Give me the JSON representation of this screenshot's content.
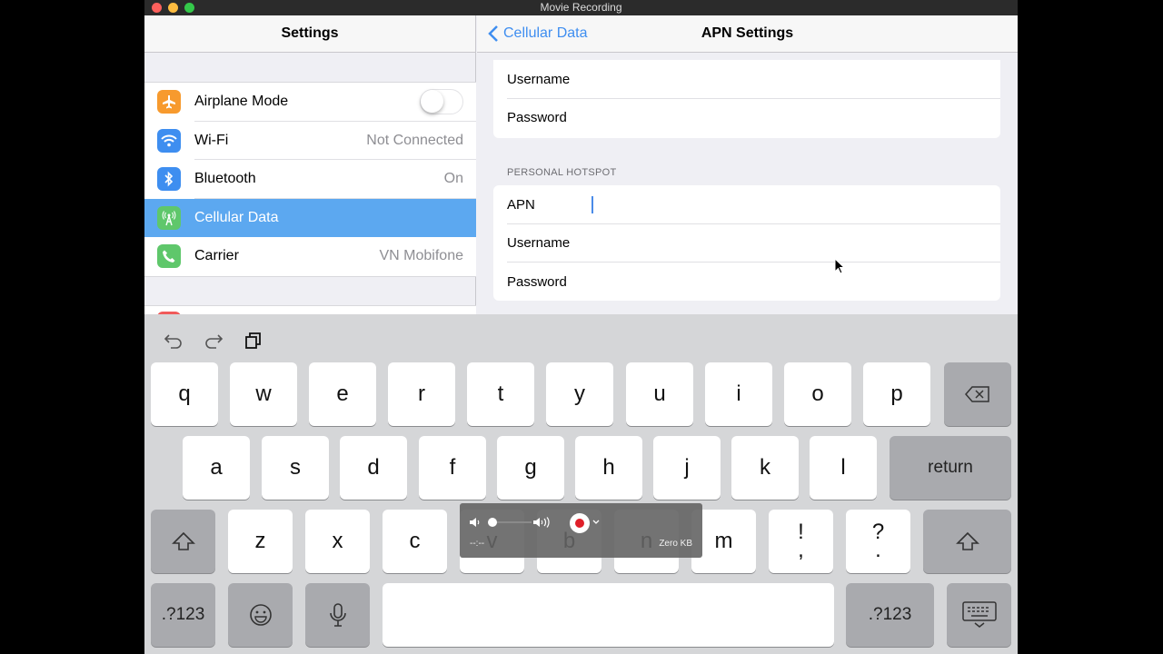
{
  "window": {
    "title": "Movie Recording"
  },
  "master": {
    "title": "Settings",
    "items": [
      {
        "label": "Airplane Mode",
        "value": "",
        "icon": "airplane-icon",
        "color": "#f79a2e"
      },
      {
        "label": "Wi-Fi",
        "value": "Not Connected",
        "icon": "wifi-icon",
        "color": "#3e8ef0"
      },
      {
        "label": "Bluetooth",
        "value": "On",
        "icon": "bluetooth-icon",
        "color": "#3e8ef0"
      },
      {
        "label": "Cellular Data",
        "value": "",
        "icon": "cellular-icon",
        "color": "#5fc76b"
      },
      {
        "label": "Carrier",
        "value": "VN Mobifone",
        "icon": "phone-icon",
        "color": "#5fc76b"
      }
    ],
    "airplane_mode_on": false,
    "selected": "Cellular Data"
  },
  "detail": {
    "back_label": "Cellular Data",
    "title": "APN Settings",
    "top_group": [
      "Username",
      "Password"
    ],
    "hotspot_header": "PERSONAL HOTSPOT",
    "hotspot_group": [
      "APN",
      "Username",
      "Password"
    ]
  },
  "keyboard": {
    "row1": [
      "q",
      "w",
      "e",
      "r",
      "t",
      "y",
      "u",
      "i",
      "o",
      "p"
    ],
    "row2": [
      "a",
      "s",
      "d",
      "f",
      "g",
      "h",
      "j",
      "k",
      "l"
    ],
    "return_label": "return",
    "row3": [
      "z",
      "x",
      "c",
      "v",
      "b",
      "n",
      "m"
    ],
    "punct1": [
      "!",
      ","
    ],
    "punct2": [
      "?",
      "."
    ],
    "numbers_label": ".?123"
  },
  "hud": {
    "time": "--:--",
    "size": "Zero KB"
  }
}
